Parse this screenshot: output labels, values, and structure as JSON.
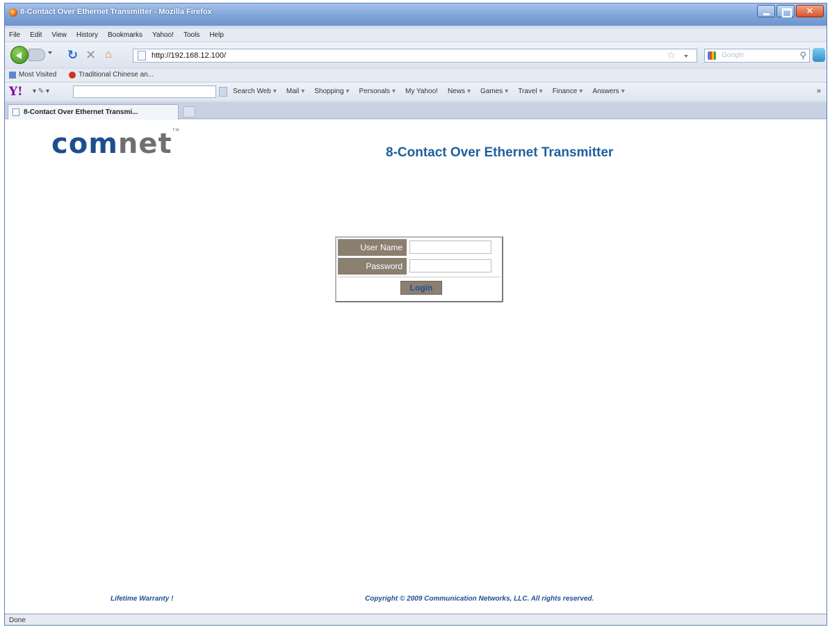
{
  "window": {
    "title": "8-Contact Over Ethernet Transmitter - Mozilla Firefox"
  },
  "menu": {
    "items": [
      "File",
      "Edit",
      "View",
      "History",
      "Bookmarks",
      "Yahoo!",
      "Tools",
      "Help"
    ]
  },
  "navbar": {
    "url": "http://192.168.12.100/",
    "search_placeholder": "Google"
  },
  "bookmarks": {
    "items": [
      "Most Visited",
      "Traditional Chinese an..."
    ]
  },
  "yahoo_toolbar": {
    "logo": "Y!",
    "items": [
      "Search Web",
      "Mail",
      "Shopping",
      "Personals",
      "My Yahoo!",
      "News",
      "Games",
      "Travel",
      "Finance",
      "Answers"
    ],
    "more": "»"
  },
  "tab": {
    "label": "8-Contact Over Ethernet Transmi..."
  },
  "page": {
    "logo_com": "com",
    "logo_net": "net",
    "logo_tm": "TM",
    "title": "8-Contact Over Ethernet Transmitter",
    "username_label": "User Name",
    "password_label": "Password",
    "login_label": "Login",
    "warranty": "Lifetime Warranty !",
    "copyright": "Copyright © 2009 Communication Networks, LLC. All rights reserved."
  },
  "status": {
    "text": "Done"
  }
}
